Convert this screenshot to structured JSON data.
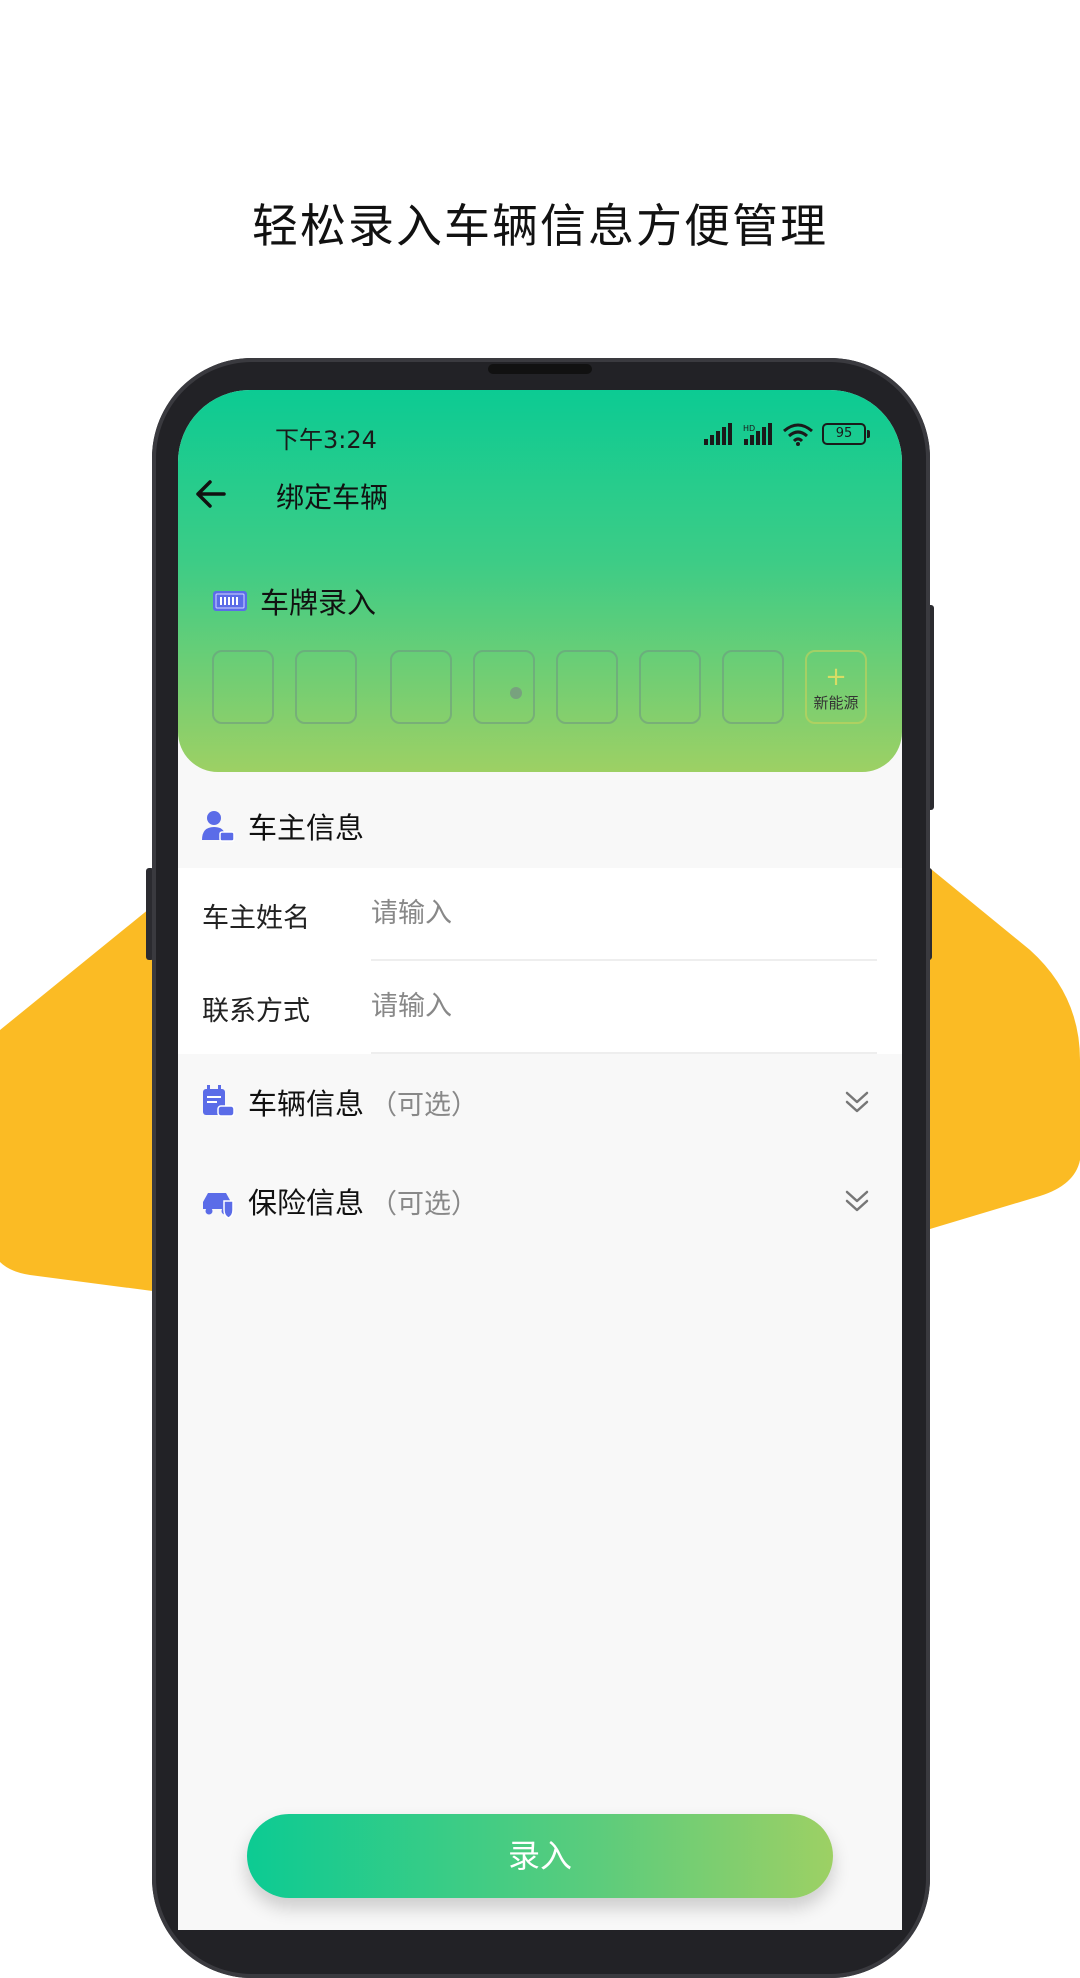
{
  "promo": {
    "headline": "轻松录入车辆信息方便管理"
  },
  "status_bar": {
    "time": "下午3:24",
    "battery": "95",
    "hd_label": "HD"
  },
  "header": {
    "title": "绑定车辆"
  },
  "plate": {
    "title": "车牌录入",
    "new_energy_label": "新能源",
    "plus": "+"
  },
  "owner": {
    "title": "车主信息",
    "fields": [
      {
        "label": "车主姓名",
        "placeholder": "请输入"
      },
      {
        "label": "联系方式",
        "placeholder": "请输入"
      }
    ]
  },
  "vehicle": {
    "title": "车辆信息",
    "optional": "（可选）"
  },
  "insurance": {
    "title": "保险信息",
    "optional": "（可选）"
  },
  "submit": {
    "label": "录入"
  },
  "colors": {
    "accent_start": "#0ccb93",
    "accent_end": "#9dd064",
    "blob": "#fbbb24",
    "icon_blue": "#5b6ce8"
  },
  "icons": [
    "back-arrow-icon",
    "license-plate-icon",
    "owner-icon",
    "vehicle-info-icon",
    "insurance-icon",
    "chevron-double-down-icon",
    "signal-icon",
    "wifi-icon",
    "battery-icon"
  ]
}
